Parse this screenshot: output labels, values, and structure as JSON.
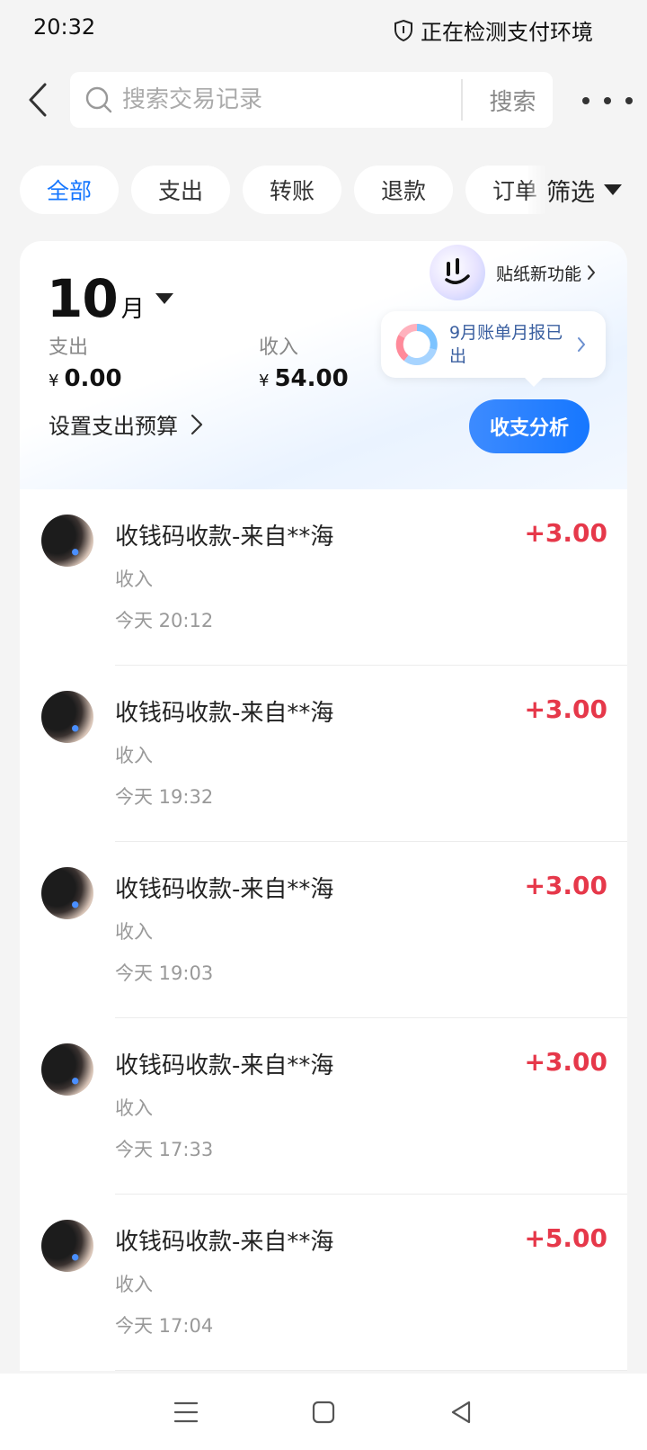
{
  "status_bar": {
    "time": "20:32",
    "security_text": "正在检测支付环境",
    "security_icon": "shield-icon"
  },
  "header": {
    "back_icon": "chevron-left-icon",
    "search_placeholder": "搜索交易记录",
    "search_button": "搜索",
    "more_icon": "more-dots-icon"
  },
  "filters": {
    "chips": [
      {
        "label": "全部",
        "active": true
      },
      {
        "label": "支出",
        "active": false
      },
      {
        "label": "转账",
        "active": false
      },
      {
        "label": "退款",
        "active": false
      },
      {
        "label": "订单",
        "active": false
      }
    ],
    "filter_button": "筛选"
  },
  "summary": {
    "month_number": "10",
    "month_unit": "月",
    "expense_label": "支出",
    "expense_currency": "¥",
    "expense_value": "0.00",
    "income_label": "收入",
    "income_currency": "¥",
    "income_value": "54.00",
    "budget_link": "设置支出预算",
    "analysis_button": "收支分析",
    "sticker_label": "贴纸新功能",
    "report_text": "9月账单月报已出"
  },
  "colors": {
    "accent": "#1677ff",
    "income_amount": "#e6384a",
    "background": "#f4f4f4"
  },
  "transactions": [
    {
      "title": "收钱码收款-来自**海",
      "type": "收入",
      "time": "今天 20:12",
      "amount": "+3.00"
    },
    {
      "title": "收钱码收款-来自**海",
      "type": "收入",
      "time": "今天 19:32",
      "amount": "+3.00"
    },
    {
      "title": "收钱码收款-来自**海",
      "type": "收入",
      "time": "今天 19:03",
      "amount": "+3.00"
    },
    {
      "title": "收钱码收款-来自**海",
      "type": "收入",
      "time": "今天 17:33",
      "amount": "+3.00"
    },
    {
      "title": "收钱码收款-来自**海",
      "type": "收入",
      "time": "今天 17:04",
      "amount": "+5.00"
    }
  ],
  "nav": {
    "menu_icon": "menu-icon",
    "home_icon": "home-square-icon",
    "back_icon": "back-triangle-icon"
  }
}
